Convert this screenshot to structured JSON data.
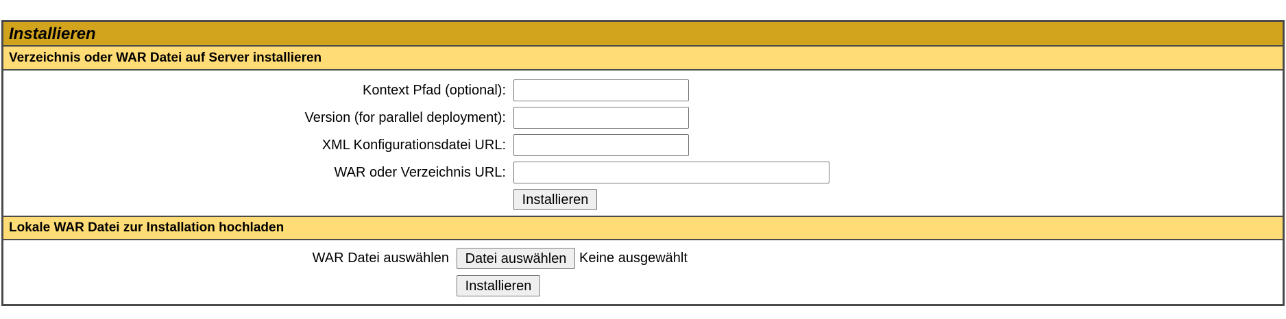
{
  "page": {
    "title": "Installieren"
  },
  "server_section": {
    "heading": "Verzeichnis oder WAR Datei auf Server installieren",
    "fields": [
      {
        "label": "Kontext Pfad (optional):",
        "value": ""
      },
      {
        "label": "Version (for parallel deployment):",
        "value": ""
      },
      {
        "label": "XML Konfigurationsdatei URL:",
        "value": ""
      },
      {
        "label": "WAR oder Verzeichnis URL:",
        "value": ""
      }
    ],
    "submit_label": "Installieren"
  },
  "upload_section": {
    "heading": "Lokale WAR Datei zur Installation hochladen",
    "file_label": "WAR Datei auswählen",
    "choose_button_label": "Datei auswählen",
    "no_file_text": "Keine ausgewählt",
    "submit_label": "Installieren"
  },
  "colors": {
    "title_bar": "#d2a41e",
    "section_bar": "#ffdc75",
    "border": "#4a4a4a"
  }
}
